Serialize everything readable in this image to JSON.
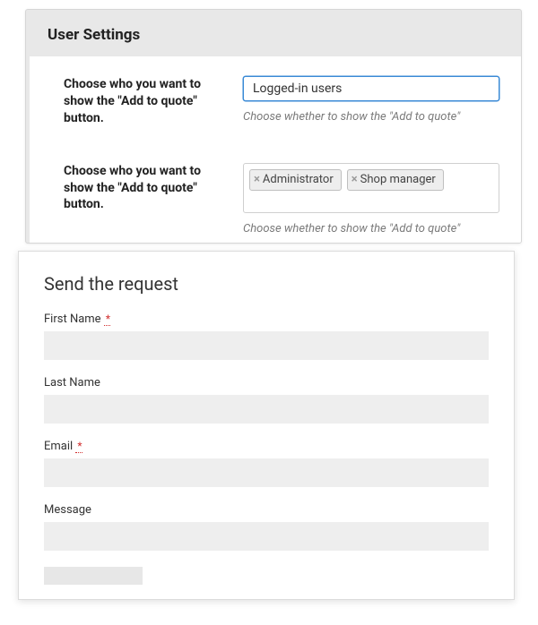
{
  "settings": {
    "title": "User Settings",
    "rows": [
      {
        "label": "Choose who you want to show the \"Add to quote\" button.",
        "select_value": "Logged-in users",
        "description": "Choose whether to show the \"Add to quote\""
      },
      {
        "label": "Choose who you want to show the \"Add to quote\" button.",
        "tokens": [
          "Administrator",
          "Shop manager"
        ],
        "description": "Choose whether to show the \"Add to quote\""
      }
    ]
  },
  "form": {
    "title": "Send the request",
    "fields": {
      "first_name": {
        "label": "First Name",
        "required_mark": "*",
        "value": ""
      },
      "last_name": {
        "label": "Last Name",
        "value": ""
      },
      "email": {
        "label": "Email",
        "required_mark": "*",
        "value": ""
      },
      "message": {
        "label": "Message",
        "value": ""
      }
    }
  }
}
